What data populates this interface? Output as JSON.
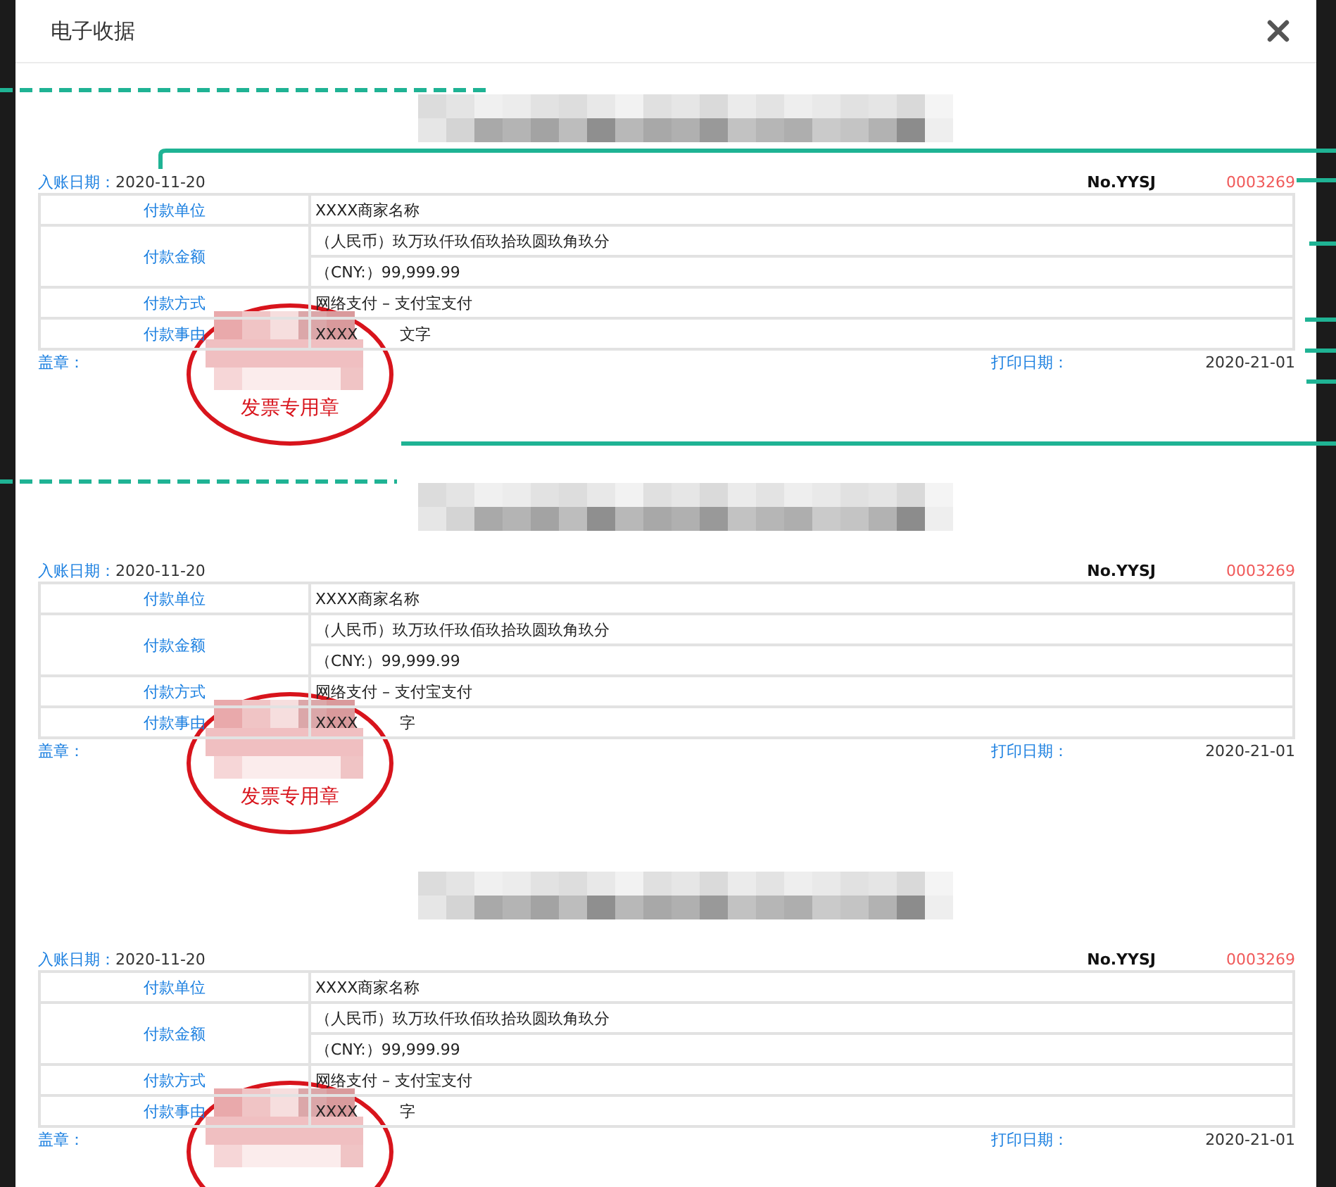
{
  "dialog": {
    "title": "电子收据"
  },
  "receipts": [
    {
      "entry_date_label": "入账日期：",
      "entry_date": "2020-11-20",
      "number_prefix": "No.YYSJ",
      "number": "0003269",
      "rows": [
        {
          "label": "付款单位",
          "values": [
            "XXXX商家名称"
          ]
        },
        {
          "label": "付款金额",
          "values": [
            "（人民币）玖万玖仟玖佰玖拾玖圆玖角玖分",
            "（CNY:）99,999.99"
          ]
        },
        {
          "label": "付款方式",
          "values": [
            "网络支付 – 支付宝支付"
          ]
        },
        {
          "label": "付款事由",
          "values": [
            "XXXX"
          ],
          "tail": "文字"
        }
      ],
      "seal_label": "盖章：",
      "print_date_label": "打印日期：",
      "print_date": "2020-21-01",
      "stamped": true,
      "stamp_text": "发票专用章"
    },
    {
      "entry_date_label": "入账日期：",
      "entry_date": "2020-11-20",
      "number_prefix": "No.YYSJ",
      "number": "0003269",
      "rows": [
        {
          "label": "付款单位",
          "values": [
            "XXXX商家名称"
          ]
        },
        {
          "label": "付款金额",
          "values": [
            "（人民币）玖万玖仟玖佰玖拾玖圆玖角玖分",
            "（CNY:）99,999.99"
          ]
        },
        {
          "label": "付款方式",
          "values": [
            "网络支付 – 支付宝支付"
          ]
        },
        {
          "label": "付款事由",
          "values": [
            "XXXX"
          ],
          "tail": "字"
        }
      ],
      "seal_label": "盖章：",
      "print_date_label": "打印日期：",
      "print_date": "2020-21-01",
      "stamped": true,
      "stamp_text": "发票专用章"
    },
    {
      "entry_date_label": "入账日期：",
      "entry_date": "2020-11-20",
      "number_prefix": "No.YYSJ",
      "number": "0003269",
      "rows": [
        {
          "label": "付款单位",
          "values": [
            "XXXX商家名称"
          ]
        },
        {
          "label": "付款金额",
          "values": [
            "（人民币）玖万玖仟玖佰玖拾玖圆玖角玖分",
            "（CNY:）99,999.99"
          ]
        },
        {
          "label": "付款方式",
          "values": [
            "网络支付 – 支付宝支付"
          ]
        },
        {
          "label": "付款事由",
          "values": [
            "XXXX"
          ],
          "tail": "字"
        }
      ],
      "seal_label": "盖章：",
      "print_date_label": "打印日期：",
      "print_date": "2020-21-01",
      "stamped": true
    }
  ]
}
